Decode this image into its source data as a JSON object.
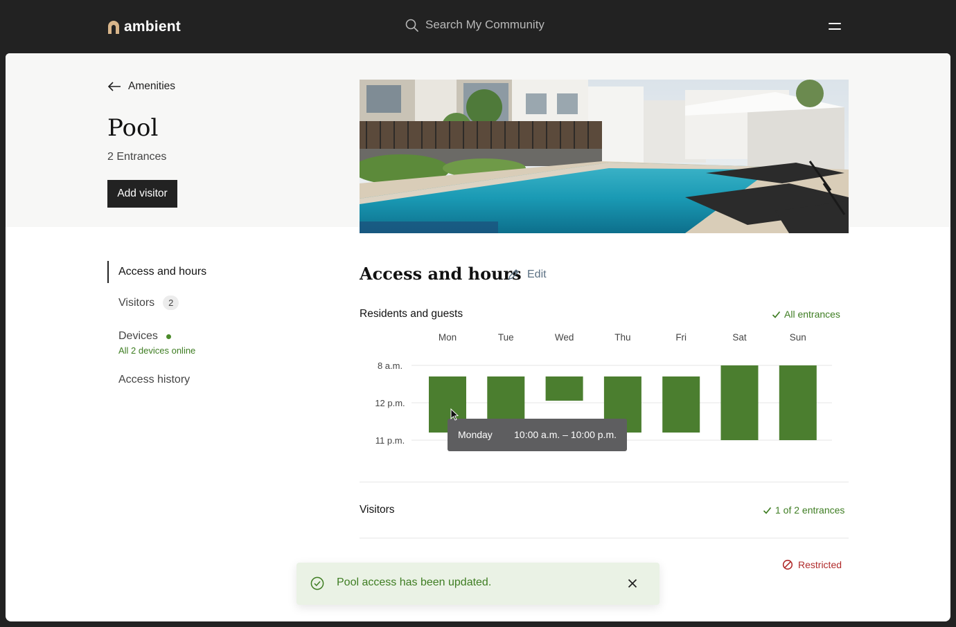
{
  "header": {
    "brand": "ambient",
    "search_placeholder": "Search My Community",
    "colors": {
      "bar": "#222222",
      "brand_mark": "#d8b58a"
    }
  },
  "page": {
    "back_label": "Amenities",
    "title": "Pool",
    "subtitle": "2 Entrances",
    "add_visitor_label": "Add visitor"
  },
  "nav": {
    "items": [
      {
        "label": "Access and hours",
        "active": true
      },
      {
        "label": "Visitors",
        "badge": "2"
      },
      {
        "label": "Devices",
        "status": "All 2 devices online"
      },
      {
        "label": "Access history"
      }
    ]
  },
  "access": {
    "title": "Access and hours",
    "edit_label": "Edit",
    "residents_label": "Residents and guests",
    "residents_status": "All entrances",
    "visitors_label": "Visitors",
    "visitors_status": "1 of 2 entrances",
    "restricted_label": "Restricted"
  },
  "chart_data": {
    "type": "bar",
    "categories": [
      "Mon",
      "Tue",
      "Wed",
      "Thu",
      "Fri",
      "Sat",
      "Sun"
    ],
    "y_tick_labels": [
      "8 a.m.",
      "12 p.m.",
      "11 p.m."
    ],
    "bar_color": "#4b7e2f",
    "tooltip": {
      "day": "Monday",
      "hours": "10:00 a.m. – 10:00 p.m."
    }
  },
  "toast": {
    "message": "Pool access has been updated.",
    "color": "#3e7d22"
  }
}
